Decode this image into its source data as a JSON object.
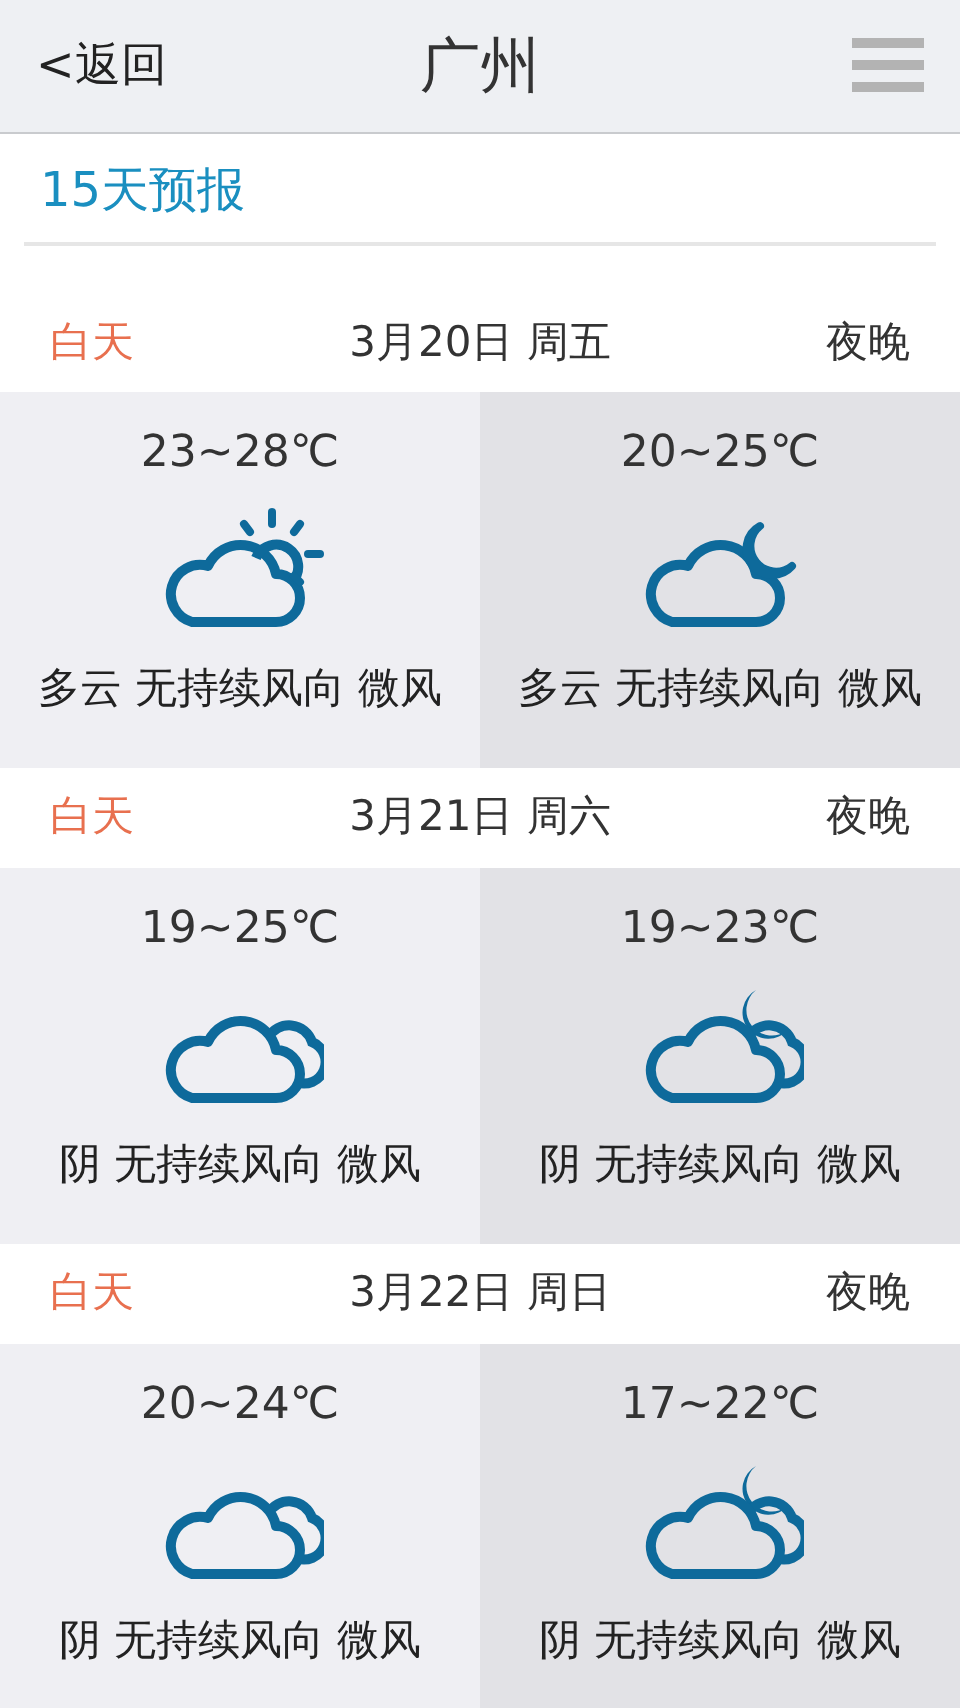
{
  "header": {
    "back": "<返回",
    "title": "广州"
  },
  "section_title": "15天预报",
  "days": [
    {
      "day_label": "白天",
      "date": "3月20日 周五",
      "night_label": "夜晚",
      "day": {
        "temp": "23~28℃",
        "kind": "partly-sunny",
        "desc": "多云 无持续风向 微风"
      },
      "night": {
        "temp": "20~25℃",
        "kind": "partly-moon",
        "desc": "多云 无持续风向 微风"
      }
    },
    {
      "day_label": "白天",
      "date": "3月21日 周六",
      "night_label": "夜晚",
      "day": {
        "temp": "19~25℃",
        "kind": "cloudy",
        "desc": "阴 无持续风向 微风"
      },
      "night": {
        "temp": "19~23℃",
        "kind": "cloudy-moon",
        "desc": "阴 无持续风向 微风"
      }
    },
    {
      "day_label": "白天",
      "date": "3月22日 周日",
      "night_label": "夜晚",
      "day": {
        "temp": "20~24℃",
        "kind": "cloudy",
        "desc": "阴 无持续风向 微风"
      },
      "night": {
        "temp": "17~22℃",
        "kind": "cloudy-moon",
        "desc": "阴 无持续风向 微风"
      }
    }
  ]
}
